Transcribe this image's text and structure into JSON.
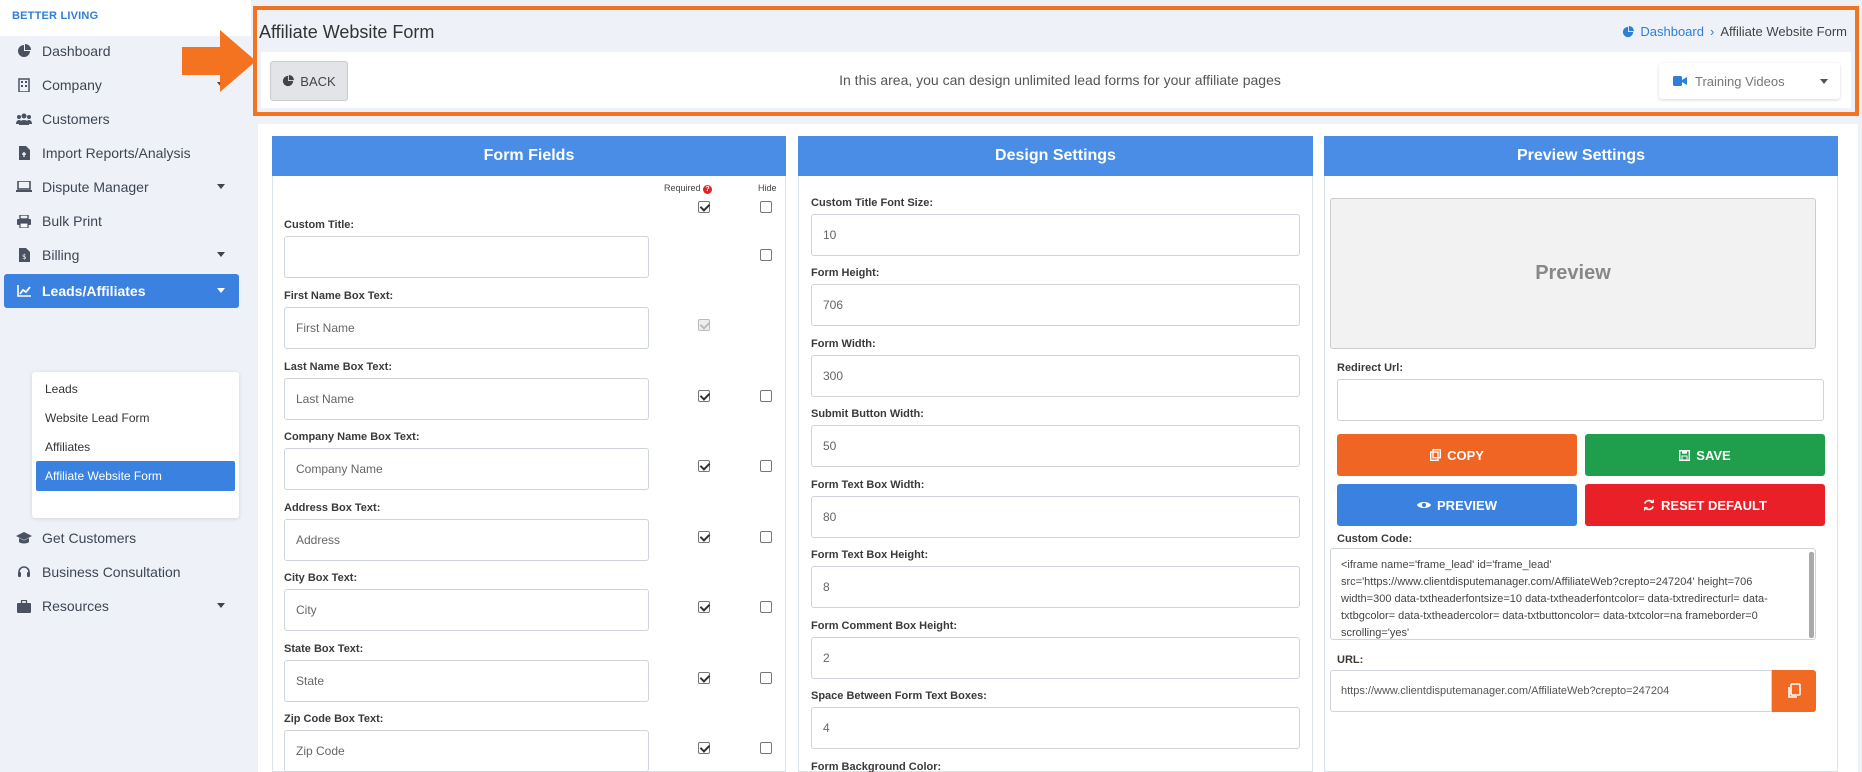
{
  "brand": "BETTER LIVING",
  "sidebar": {
    "items": [
      {
        "label": "Dashboard",
        "icon": "pie-chart-icon",
        "caret": false
      },
      {
        "label": "Company",
        "icon": "building-icon",
        "caret": true
      },
      {
        "label": "Customers",
        "icon": "users-icon",
        "caret": false
      },
      {
        "label": "Import Reports/Analysis",
        "icon": "file-import-icon",
        "caret": false
      },
      {
        "label": "Dispute Manager",
        "icon": "laptop-icon",
        "caret": true
      },
      {
        "label": "Bulk Print",
        "icon": "printer-icon",
        "caret": false
      },
      {
        "label": "Billing",
        "icon": "invoice-icon",
        "caret": true
      },
      {
        "label": "Leads/Affiliates",
        "icon": "chart-line-icon",
        "caret": true
      },
      {
        "label": "Get Customers",
        "icon": "graduation-cap-icon",
        "caret": false
      },
      {
        "label": "Business Consultation",
        "icon": "headset-icon",
        "caret": false
      },
      {
        "label": "Resources",
        "icon": "briefcase-icon",
        "caret": true
      }
    ],
    "submenu": [
      "Leads",
      "Website Lead Form",
      "Affiliates",
      "Affiliate Website Form"
    ]
  },
  "header": {
    "title": "Affiliate Website Form",
    "breadcrumb_home": "Dashboard",
    "breadcrumb_current": "Affiliate Website Form",
    "back_label": "BACK",
    "intro": "In this area, you can design unlimited lead forms for your affiliate pages",
    "training_label": "Training Videos"
  },
  "form_fields": {
    "title": "Form Fields",
    "required_label": "Required",
    "hide_label": "Hide",
    "fields": [
      {
        "label": "Custom Title:",
        "placeholder": ""
      },
      {
        "label": "First Name Box Text:",
        "placeholder": "First Name"
      },
      {
        "label": "Last Name Box Text:",
        "placeholder": "Last Name"
      },
      {
        "label": "Company Name Box Text:",
        "placeholder": "Company Name"
      },
      {
        "label": "Address Box Text:",
        "placeholder": "Address"
      },
      {
        "label": "City Box Text:",
        "placeholder": "City"
      },
      {
        "label": "State Box Text:",
        "placeholder": "State"
      },
      {
        "label": "Zip Code Box Text:",
        "placeholder": "Zip Code"
      }
    ]
  },
  "design_settings": {
    "title": "Design Settings",
    "fields": [
      {
        "label": "Custom Title Font Size:",
        "value": "10"
      },
      {
        "label": "Form Height:",
        "value": "706"
      },
      {
        "label": "Form Width:",
        "value": "300"
      },
      {
        "label": "Submit Button Width:",
        "value": "50"
      },
      {
        "label": "Form Text Box Width:",
        "value": "80"
      },
      {
        "label": "Form Text Box Height:",
        "value": "8"
      },
      {
        "label": "Form Comment Box Height:",
        "value": "2"
      },
      {
        "label": "Space Between Form Text Boxes:",
        "value": "4"
      },
      {
        "label": "Form Background Color:",
        "value": ""
      }
    ]
  },
  "preview_settings": {
    "title": "Preview Settings",
    "preview_label": "Preview",
    "redirect_label": "Redirect Url:",
    "copy_label": "COPY",
    "save_label": "SAVE",
    "preview_btn_label": "PREVIEW",
    "reset_label": "RESET DEFAULT",
    "custom_code_label": "Custom Code:",
    "custom_code": "<iframe name='frame_lead' id='frame_lead' src='https://www.clientdisputemanager.com/AffiliateWeb?crepto=247204' height=706 width=300 data-txtheaderfontsize=10 data-txtheaderfontcolor= data-txtredirecturl= data-txtbgcolor= data-txtheadercolor= data-txtbuttoncolor= data-txtcolor=na frameborder=0  scrolling='yes'",
    "url_label": "URL:",
    "url_value": "https://www.clientdisputemanager.com/AffiliateWeb?crepto=247204"
  },
  "colors": {
    "primary": "#3b82e0",
    "highlight": "#f07422",
    "copy": "#f06424",
    "save": "#1f9e4c",
    "preview": "#3b82e0",
    "reset": "#e92027"
  }
}
